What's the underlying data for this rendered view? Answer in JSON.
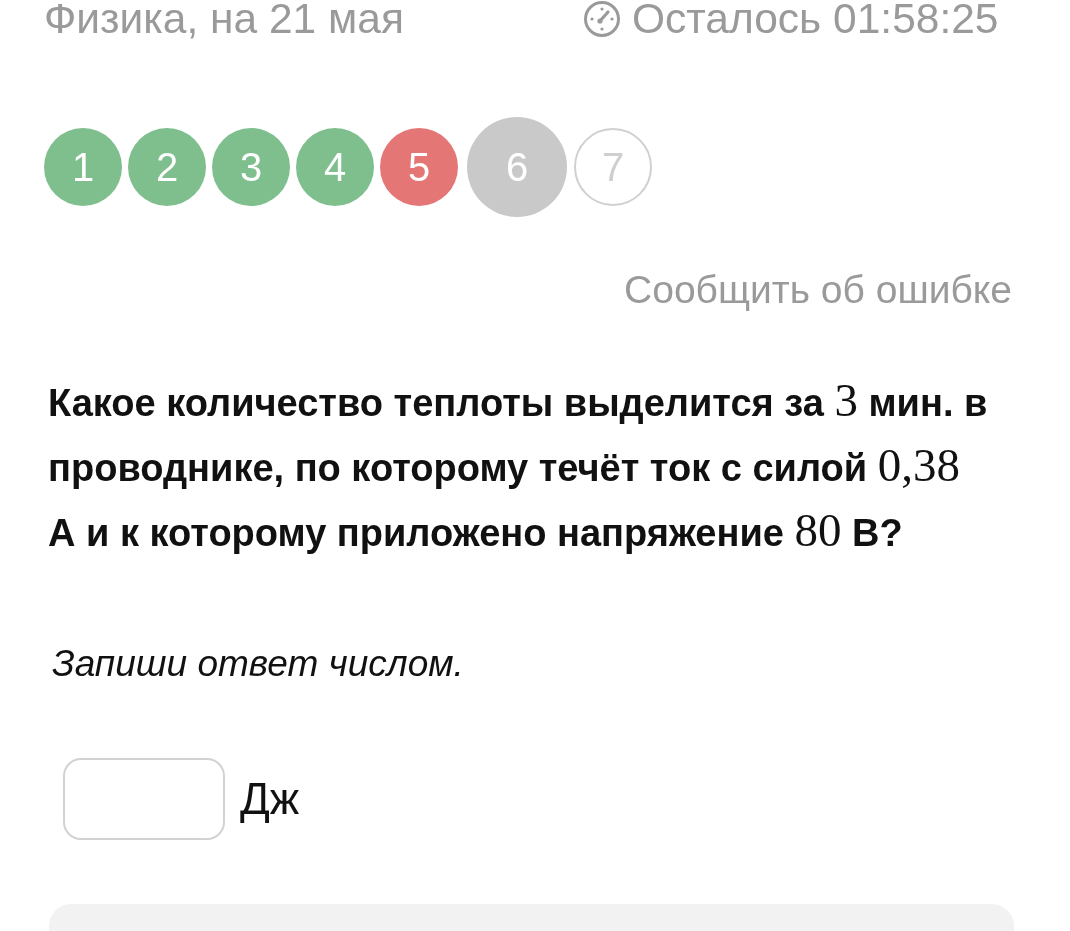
{
  "header": {
    "subject": "Физика, на 21 мая",
    "timer": "Осталось 01:58:25"
  },
  "progress": [
    {
      "label": "1",
      "kind": "correct",
      "selected": false
    },
    {
      "label": "2",
      "kind": "correct",
      "selected": false
    },
    {
      "label": "3",
      "kind": "correct",
      "selected": false
    },
    {
      "label": "4",
      "kind": "correct",
      "selected": false
    },
    {
      "label": "5",
      "kind": "wrong",
      "selected": false
    },
    {
      "label": "6",
      "kind": "unanswered",
      "selected": true
    },
    {
      "label": "7",
      "kind": "unanswered",
      "selected": false
    }
  ],
  "report_link": "Сообщить об ошибке",
  "question": {
    "segments": [
      {
        "kind": "text",
        "text": "Какое количество теплоты выделится за "
      },
      {
        "kind": "math",
        "text": "3"
      },
      {
        "kind": "text",
        "text": " мин. в проводнике, по которому течёт ток с силой "
      },
      {
        "kind": "math",
        "text": "0,38"
      },
      {
        "kind": "text",
        "text": " А и к которому приложено напряжение "
      },
      {
        "kind": "math",
        "text": "80"
      },
      {
        "kind": "text",
        "text": " В?"
      }
    ]
  },
  "instruction": "Запиши ответ числом.",
  "answer": {
    "unit": "Дж"
  }
}
